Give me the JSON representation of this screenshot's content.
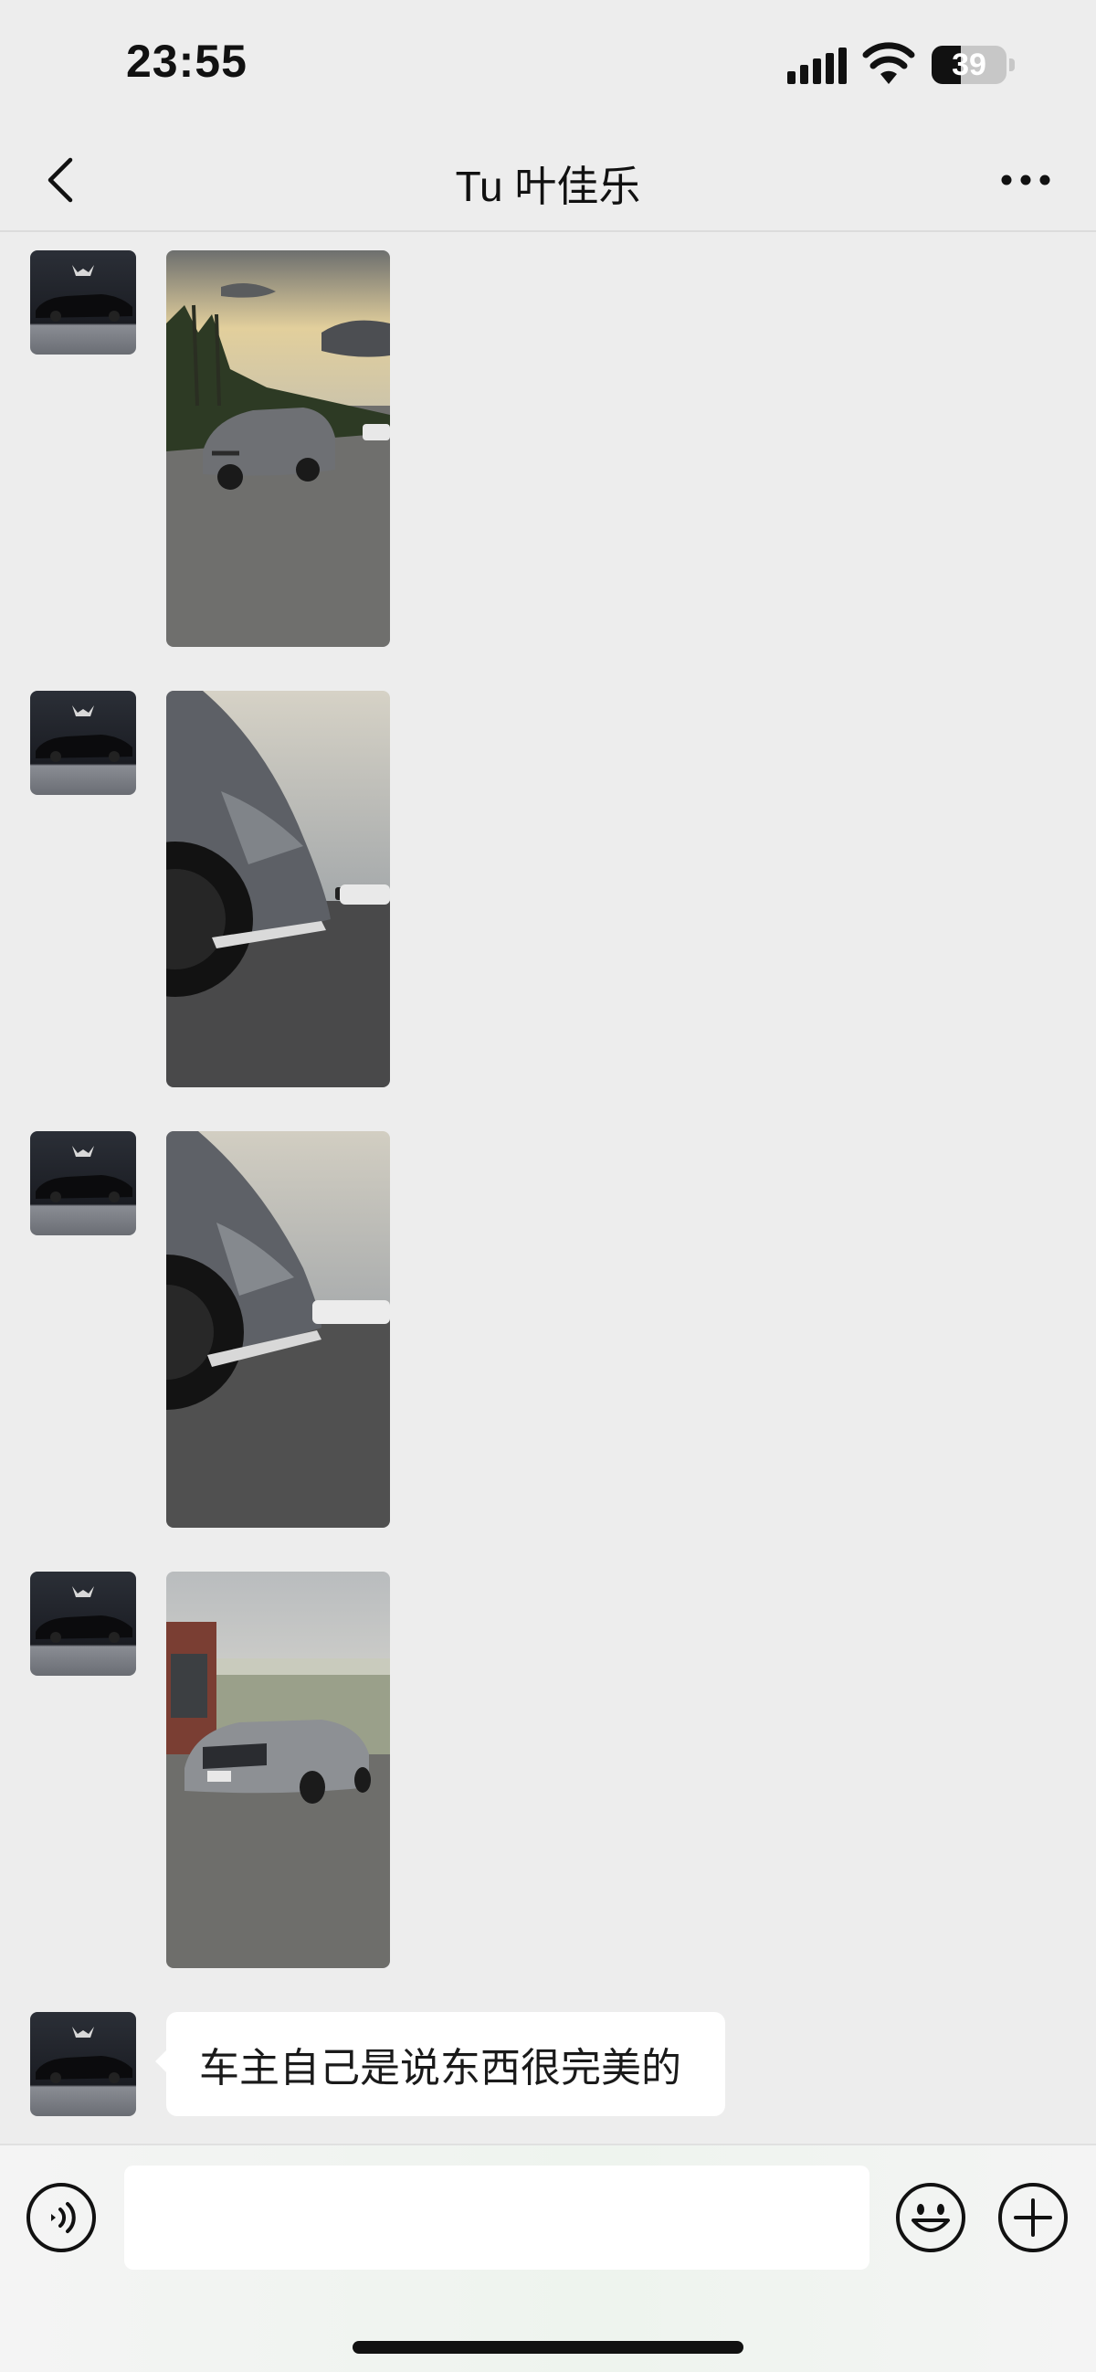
{
  "status_bar": {
    "time": "23:55",
    "battery_level": "39",
    "battery_fraction": 0.39,
    "icons": [
      "signal-icon",
      "wifi-icon",
      "battery-icon"
    ]
  },
  "nav": {
    "title": "Tu 叶佳乐",
    "back_icon": "chevron-left-icon",
    "more_icon": "more-dots-icon"
  },
  "messages": [
    {
      "type": "image",
      "sender": "contact",
      "avatar": "car-avatar",
      "photo": "grey sedan rear view, palm trees, sunset sky"
    },
    {
      "type": "image",
      "sender": "contact",
      "avatar": "car-avatar",
      "photo": "grey sedan side close-up, wheel and door"
    },
    {
      "type": "image",
      "sender": "contact",
      "avatar": "car-avatar",
      "photo": "grey sedan side close-up, wheel and sill"
    },
    {
      "type": "image",
      "sender": "contact",
      "avatar": "car-avatar",
      "photo": "grey sedan front view in front of building"
    },
    {
      "type": "text",
      "sender": "contact",
      "avatar": "car-avatar",
      "text": "车主自己是说东西很完美的"
    }
  ],
  "input_bar": {
    "placeholder": "",
    "value": "",
    "icons": [
      "voice-icon",
      "emoji-icon",
      "plus-icon"
    ]
  },
  "colors": {
    "background": "#ededed",
    "bubble": "#ffffff",
    "text": "#111111"
  }
}
